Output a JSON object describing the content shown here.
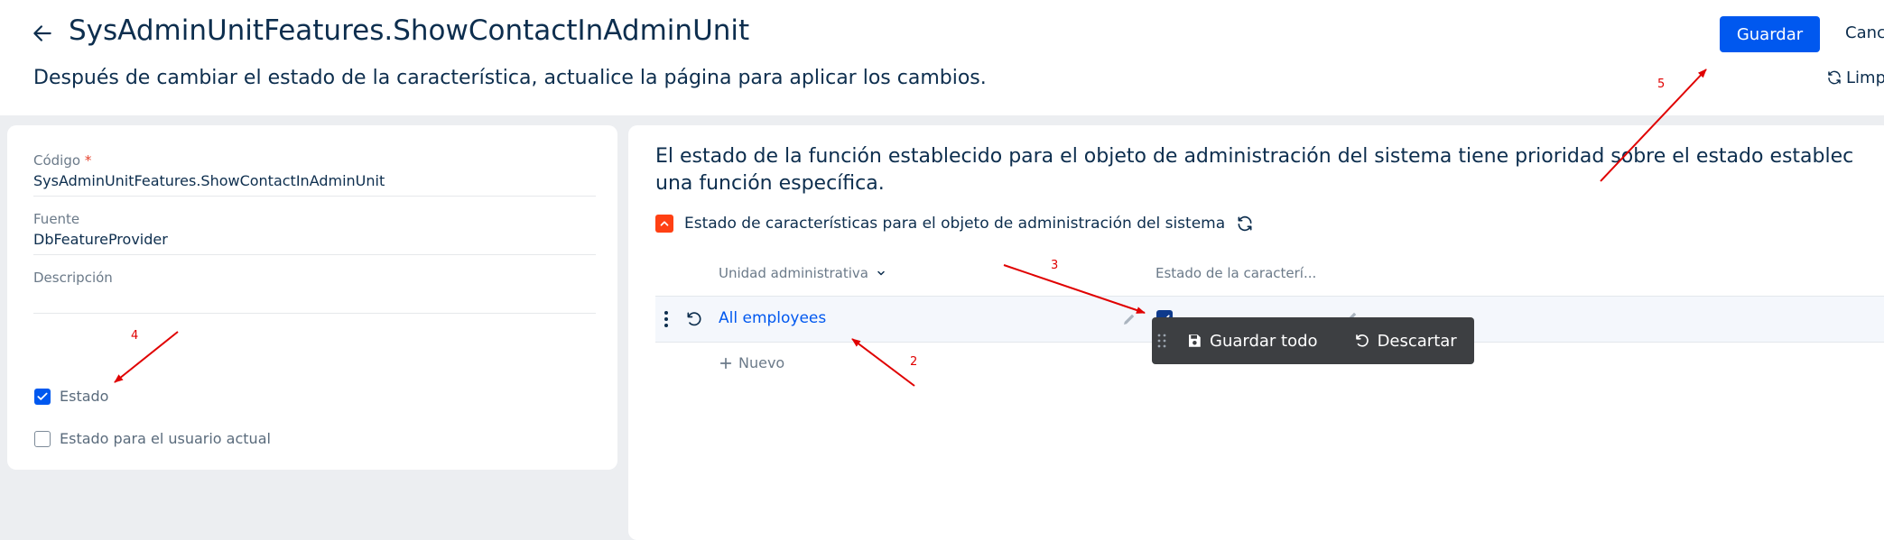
{
  "header": {
    "title": "SysAdminUnitFeatures.ShowContactInAdminUnit",
    "subtitle": "Después de cambiar el estado de la característica, actualice la página para aplicar los cambios.",
    "save_label": "Guardar",
    "cancel_label": "Canc",
    "clear_label": "Limp"
  },
  "form": {
    "code_label": "Código",
    "code_value": "SysAdminUnitFeatures.ShowContactInAdminUnit",
    "source_label": "Fuente",
    "source_value": "DbFeatureProvider",
    "description_label": "Descripción",
    "state_label": "Estado",
    "state_checked": true,
    "user_state_label": "Estado para el usuario actual",
    "user_state_checked": false
  },
  "detail": {
    "info_line1": "El estado de la función establecido para el objeto de administración del sistema tiene prioridad sobre el estado establec",
    "info_line2": "una función específica.",
    "section_title": "Estado de características para el objeto de administración del sistema",
    "columns": [
      "Unidad administrativa",
      "Estado de la caracterí..."
    ],
    "rows": [
      {
        "unit": "All employees",
        "state": true
      }
    ],
    "new_label": "Nuevo",
    "save_all_label": "Guardar todo",
    "discard_label": "Descartar"
  },
  "annotations": [
    "2",
    "3",
    "4",
    "5"
  ],
  "colors": {
    "accent": "#0058ef",
    "section_toggle": "#ff4013",
    "annotation": "#e00000",
    "toolbar": "#3d3f42"
  }
}
